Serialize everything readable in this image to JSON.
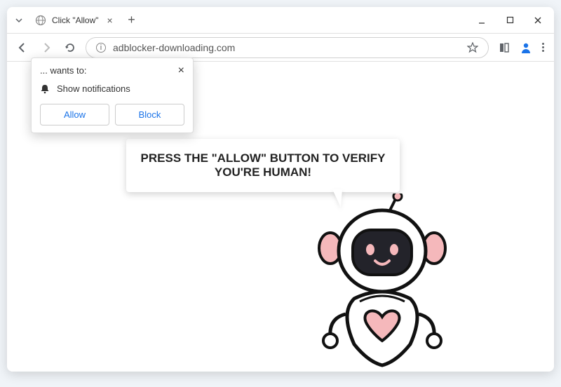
{
  "window": {
    "tab_title": "Click \"Allow\""
  },
  "toolbar": {
    "url": "adblocker-downloading.com"
  },
  "popup": {
    "wants_to": "... wants to:",
    "show_notifications": "Show notifications",
    "allow": "Allow",
    "block": "Block"
  },
  "page": {
    "bubble_text": "PRESS THE \"ALLOW\" BUTTON TO VERIFY YOU'RE HUMAN!"
  },
  "colors": {
    "pink": "#f5b8bb",
    "dark": "#23232a",
    "outline": "#111"
  }
}
